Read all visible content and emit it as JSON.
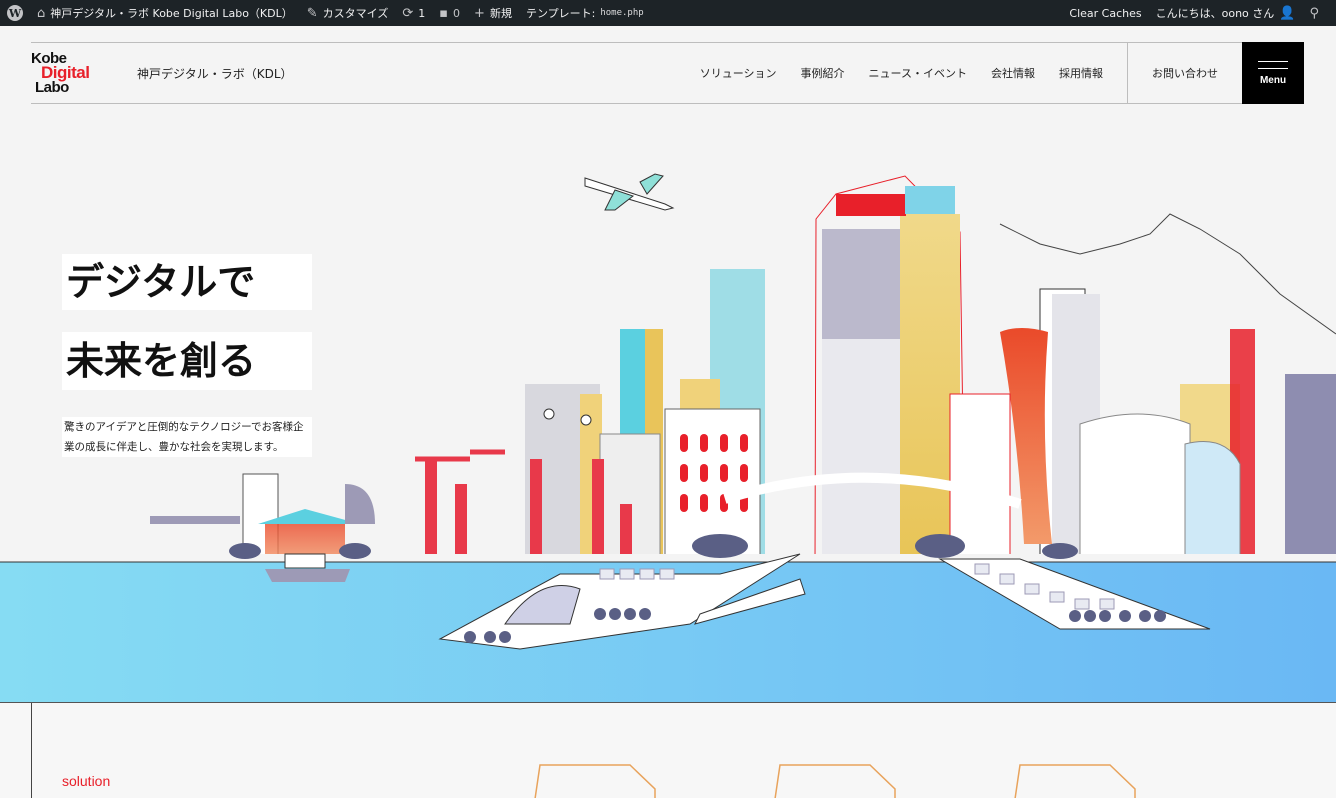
{
  "adminbar": {
    "site_name": "神戸デジタル・ラボ Kobe Digital Labo（KDL）",
    "customize": "カスタマイズ",
    "updates_count": "1",
    "comments_count": "0",
    "new_label": "新規",
    "template_label": "テンプレート:",
    "template_file": "home.php",
    "clear_caches": "Clear Caches",
    "greeting": "こんにちは、oono さん"
  },
  "header": {
    "logo_line1": "Kobe",
    "logo_line2": "Digital",
    "logo_line3": "Labo",
    "site_name": "神戸デジタル・ラボ（KDL）",
    "nav": [
      "ソリューション",
      "事例紹介",
      "ニュース・イベント",
      "会社情報",
      "採用情報"
    ],
    "contact": "お問い合わせ",
    "menu_label": "Menu"
  },
  "hero": {
    "catch_line1": "デジタルで",
    "catch_line2": "未来を創る",
    "lead": "驚きのアイデアと圧倒的なテクノロジーでお客様企業の成長に伴走し、豊かな社会を実現します。"
  },
  "section": {
    "label": "solution"
  },
  "colors": {
    "accent_red": "#e8202a",
    "admin_bg": "#1d2327",
    "sea": "#7fd3f2",
    "orange_outline": "#e8a35c"
  }
}
